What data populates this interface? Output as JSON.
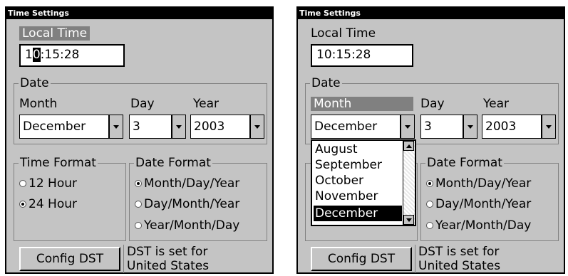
{
  "title": "Time Settings",
  "local_time_label": "Local Time",
  "time_value": "10:15:28",
  "time_value_parts": {
    "before": "1",
    "cursor": "0",
    "after": ":15:28"
  },
  "date_group": "Date",
  "month_label": "Month",
  "day_label": "Day",
  "year_label": "Year",
  "month_value": "December",
  "day_value": "3",
  "year_value": "2003",
  "time_format": {
    "title": "Time Format",
    "options": [
      "12 Hour",
      "24 Hour"
    ],
    "selected": "24 Hour"
  },
  "date_format": {
    "title": "Date Format",
    "options": [
      "Month/Day/Year",
      "Day/Month/Year",
      "Year/Month/Day"
    ],
    "selected": "Month/Day/Year"
  },
  "config_dst_label": "Config DST",
  "dst_line1": "DST is set for",
  "dst_line2": "United States",
  "month_dropdown": {
    "items": [
      "August",
      "September",
      "October",
      "November",
      "December"
    ],
    "selected": "December"
  },
  "colors": {
    "background": "#c4c4c4",
    "titlebar": "#000000",
    "highlight": "#808080"
  }
}
